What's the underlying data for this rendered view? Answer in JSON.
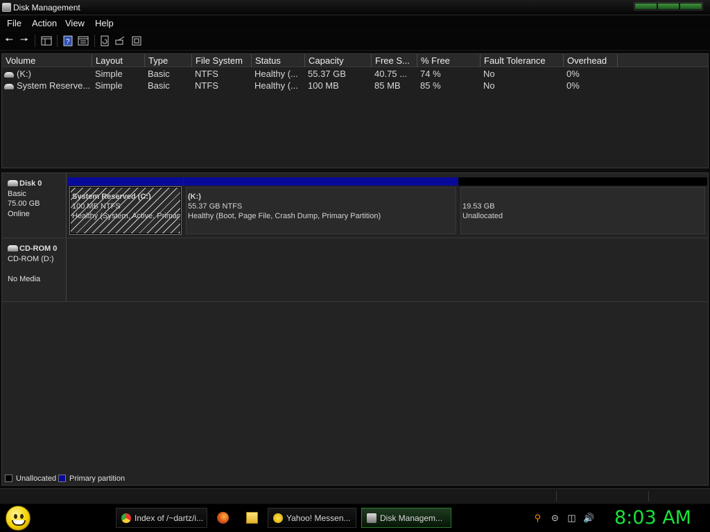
{
  "window": {
    "title": "Disk Management"
  },
  "menu": [
    "File",
    "Action",
    "View",
    "Help"
  ],
  "toolbar": {
    "buttons": [
      "back-arrow-icon",
      "forward-arrow-icon",
      "console-tree-icon",
      "help-icon",
      "properties-icon",
      "refresh-icon",
      "rescan-icon",
      "export-icon"
    ]
  },
  "volumes": {
    "columns": [
      "Volume",
      "Layout",
      "Type",
      "File System",
      "Status",
      "Capacity",
      "Free S...",
      "% Free",
      "Fault Tolerance",
      "Overhead"
    ],
    "rows": [
      {
        "volume": "(K:)",
        "layout": "Simple",
        "type": "Basic",
        "fs": "NTFS",
        "status": "Healthy (...",
        "capacity": "55.37 GB",
        "free": "40.75 ...",
        "pct_free": "74 %",
        "fault": "No",
        "overhead": "0%"
      },
      {
        "volume": "System Reserve...",
        "layout": "Simple",
        "type": "Basic",
        "fs": "NTFS",
        "status": "Healthy (...",
        "capacity": "100 MB",
        "free": "85 MB",
        "pct_free": "85 %",
        "fault": "No",
        "overhead": "0%"
      }
    ]
  },
  "disks": [
    {
      "name": "Disk 0",
      "type": "Basic",
      "size": "75.00 GB",
      "state": "Online",
      "partitions": [
        {
          "title": "System Reserved  (C:)",
          "size": "100 MB NTFS",
          "status": "Healthy (System, Active, Primary Partition)"
        },
        {
          "title": "(K:)",
          "size": "55.37 GB NTFS",
          "status": "Healthy (Boot, Page File, Crash Dump, Primary Partition)"
        },
        {
          "title": "",
          "size": "19.53 GB",
          "status": "Unallocated"
        }
      ]
    },
    {
      "name": "CD-ROM 0",
      "type": "CD-ROM (D:)",
      "state": "No Media"
    }
  ],
  "legend": [
    {
      "label": "Unallocated",
      "color": "#000000"
    },
    {
      "label": "Primary partition",
      "color": "#0a0a9a"
    }
  ],
  "colors": {
    "primary_bar": "#0a0a9a",
    "unallocated_bar": "#000000",
    "clock": "#19e23a"
  },
  "taskbar": {
    "tasks": [
      {
        "label": "Index of /~dartz/i...",
        "icon": "chrome-icon"
      },
      {
        "label": "Yahoo! Messen...",
        "icon": "yahoo-messenger-icon"
      },
      {
        "label": "Disk Managem...",
        "icon": "disk-management-icon",
        "active": true
      }
    ],
    "quick_launch": [
      "firefox-icon",
      "folder-icon"
    ],
    "tray": [
      "search-icon",
      "minus-circle-icon",
      "network-icon",
      "volume-icon"
    ],
    "clock": "8:03 AM"
  }
}
